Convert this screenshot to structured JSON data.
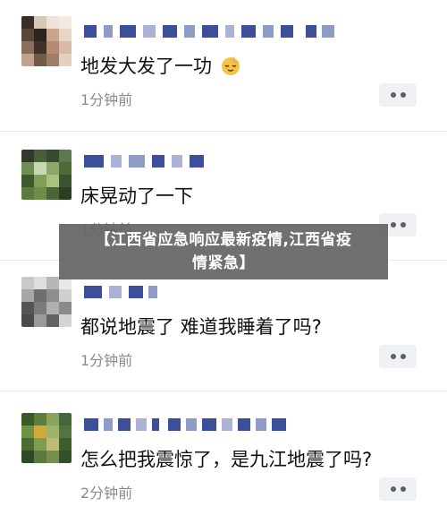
{
  "comments": [
    {
      "text": "地发大发了一功",
      "emoji": "sleepy-moon-icon",
      "time": "1分钟前"
    },
    {
      "text": "床晃动了一下",
      "time": "1分钟前"
    },
    {
      "text": "都说地震了 难道我睡着了吗?",
      "time": "1分钟前"
    },
    {
      "text": "怎么把我震惊了，是九江地震了吗?",
      "time": "2分钟前"
    }
  ],
  "banner": {
    "line1": "【江西省应急响应最新疫情,江西省疫",
    "line2": "情紧急】"
  },
  "colors": {
    "username_pixels": "#3d4f9a",
    "more_button_bg": "#f0f1f4",
    "banner_bg": "#646464"
  }
}
